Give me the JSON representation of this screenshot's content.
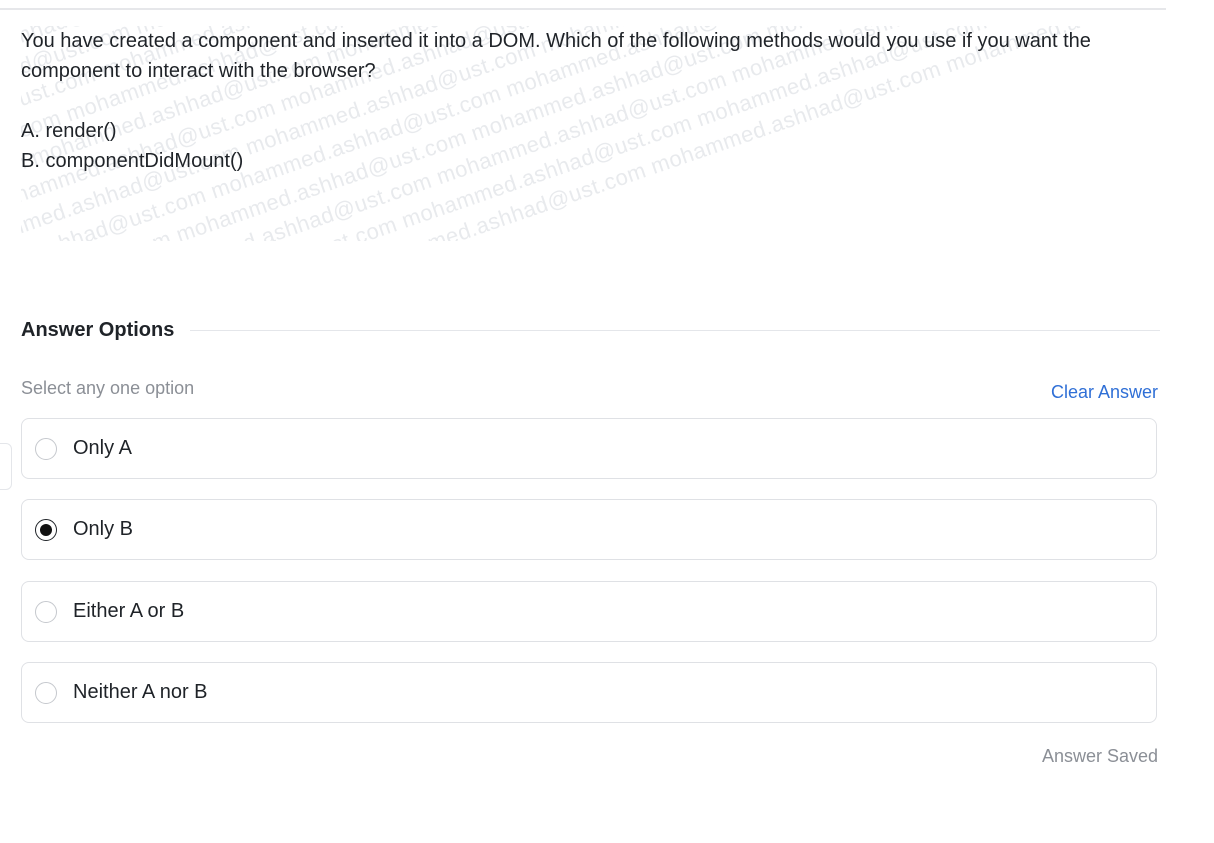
{
  "question": {
    "text": "You have created a component and inserted it into a DOM. Which of the following methods would you use if you want the component to interact with the browser?",
    "options": [
      "A. render()",
      "B. componentDidMount()"
    ]
  },
  "watermark": {
    "text": "mohammed.ashhad@ust.com"
  },
  "answer_section": {
    "title": "Answer Options",
    "hint": "Select any one option",
    "clear_label": "Clear Answer",
    "options": [
      {
        "label": "Only A",
        "selected": false
      },
      {
        "label": "Only B",
        "selected": true
      },
      {
        "label": "Either A or B",
        "selected": false
      },
      {
        "label": "Neither A nor B",
        "selected": false
      }
    ],
    "status": "Answer Saved"
  },
  "colors": {
    "accent_link": "#2f6fd6",
    "muted_text": "#8b8f96",
    "border": "#dfe1e5"
  }
}
